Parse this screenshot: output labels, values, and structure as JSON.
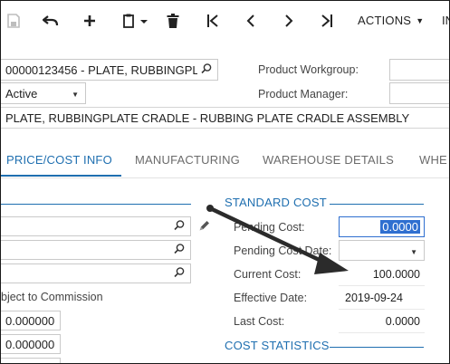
{
  "toolbar": {
    "save_icon": "save-icon",
    "undo_icon": "undo-icon",
    "add_icon": "plus-icon",
    "copy_icon": "clipboard-icon",
    "delete_icon": "trash-icon",
    "first_icon": "first-record-icon",
    "prev_icon": "previous-icon",
    "next_icon": "next-icon",
    "last_icon": "last-record-icon",
    "actions_label": "ACTIONS",
    "next_menu_partial": "IN"
  },
  "header": {
    "inventory_id": "00000123456 - PLATE, RUBBINGPLATE",
    "status": "Active",
    "description": "PLATE, RUBBINGPLATE CRADLE - RUBBING PLATE CRADLE ASSEMBLY",
    "product_workgroup_label": "Product Workgroup:",
    "product_workgroup_value": "",
    "product_manager_label": "Product Manager:",
    "product_manager_value": ""
  },
  "tabs": [
    {
      "label": "PRICE/COST INFO",
      "active": true
    },
    {
      "label": "MANUFACTURING",
      "active": false
    },
    {
      "label": "WAREHOUSE DETAILS",
      "active": false
    },
    {
      "label": "WHE",
      "active": false
    }
  ],
  "left_panel": {
    "subject_to_commission_label": "bject to Commission",
    "value_1": "0.000000",
    "value_2": "0.000000"
  },
  "standard_cost": {
    "section_title": "STANDARD COST",
    "pending_cost_label": "Pending Cost:",
    "pending_cost_value": "0.0000",
    "pending_cost_date_label": "Pending Cost Date:",
    "pending_cost_date_value": "",
    "current_cost_label": "Current Cost:",
    "current_cost_value": "100.0000",
    "effective_date_label": "Effective Date:",
    "effective_date_value": "2019-09-24",
    "last_cost_label": "Last Cost:",
    "last_cost_value": "0.0000"
  },
  "cost_statistics": {
    "section_title": "COST STATISTICS"
  },
  "colors": {
    "accent": "#1f6fb0",
    "selection": "#2f6fd0",
    "arrow": "#2b2b2b"
  }
}
